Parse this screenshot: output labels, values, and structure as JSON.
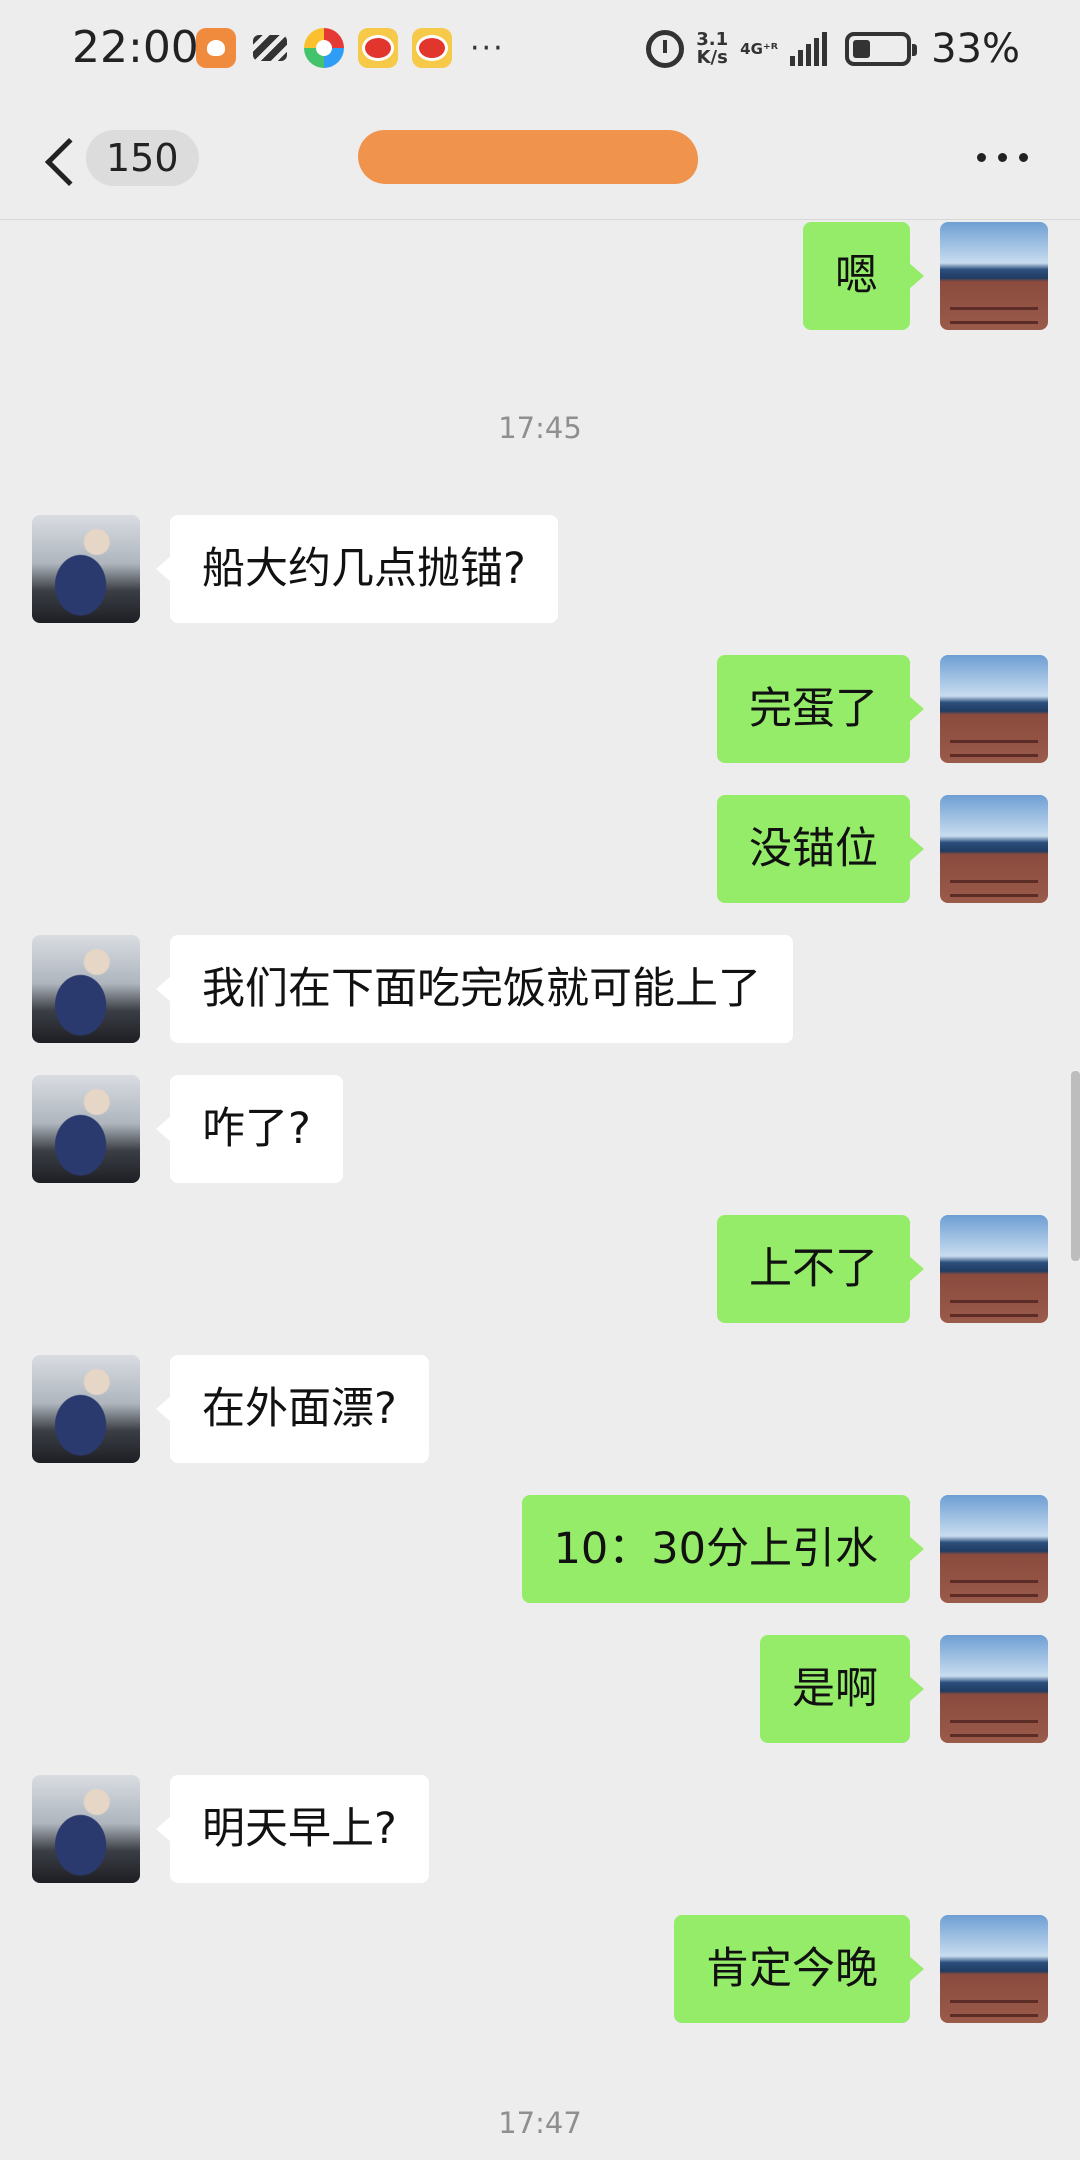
{
  "status_bar": {
    "time": "22:00",
    "speed_value": "3.1",
    "speed_unit": "K/s",
    "network": "4G⁺ᴿ",
    "battery_percent": "33%",
    "app_icons": [
      "heart-badge-icon",
      "stripes-icon",
      "pinwheel-icon",
      "weibo-icon",
      "weibo-icon"
    ],
    "more": "···"
  },
  "header": {
    "unread_count": "150",
    "contact_name": ""
  },
  "chat": {
    "messages": [
      {
        "side": "mine",
        "text": "嗯"
      },
      {
        "type": "time",
        "text": "17:45"
      },
      {
        "side": "theirs",
        "text": "船大约几点抛锚?"
      },
      {
        "side": "mine",
        "text": "完蛋了"
      },
      {
        "side": "mine",
        "text": "没锚位"
      },
      {
        "side": "theirs",
        "text": "我们在下面吃完饭就可能上了"
      },
      {
        "side": "theirs",
        "text": "咋了?"
      },
      {
        "side": "mine",
        "text": "上不了"
      },
      {
        "side": "theirs",
        "text": "在外面漂?"
      },
      {
        "side": "mine",
        "text": "10：30分上引水"
      },
      {
        "side": "mine",
        "text": "是啊"
      },
      {
        "side": "theirs",
        "text": "明天早上?"
      },
      {
        "side": "mine",
        "text": "肯定今晚"
      },
      {
        "type": "time",
        "text": "17:47"
      }
    ]
  },
  "colors": {
    "background": "#ededed",
    "my_bubble": "#95ec69",
    "their_bubble": "#ffffff",
    "redaction": "#f0944d"
  }
}
